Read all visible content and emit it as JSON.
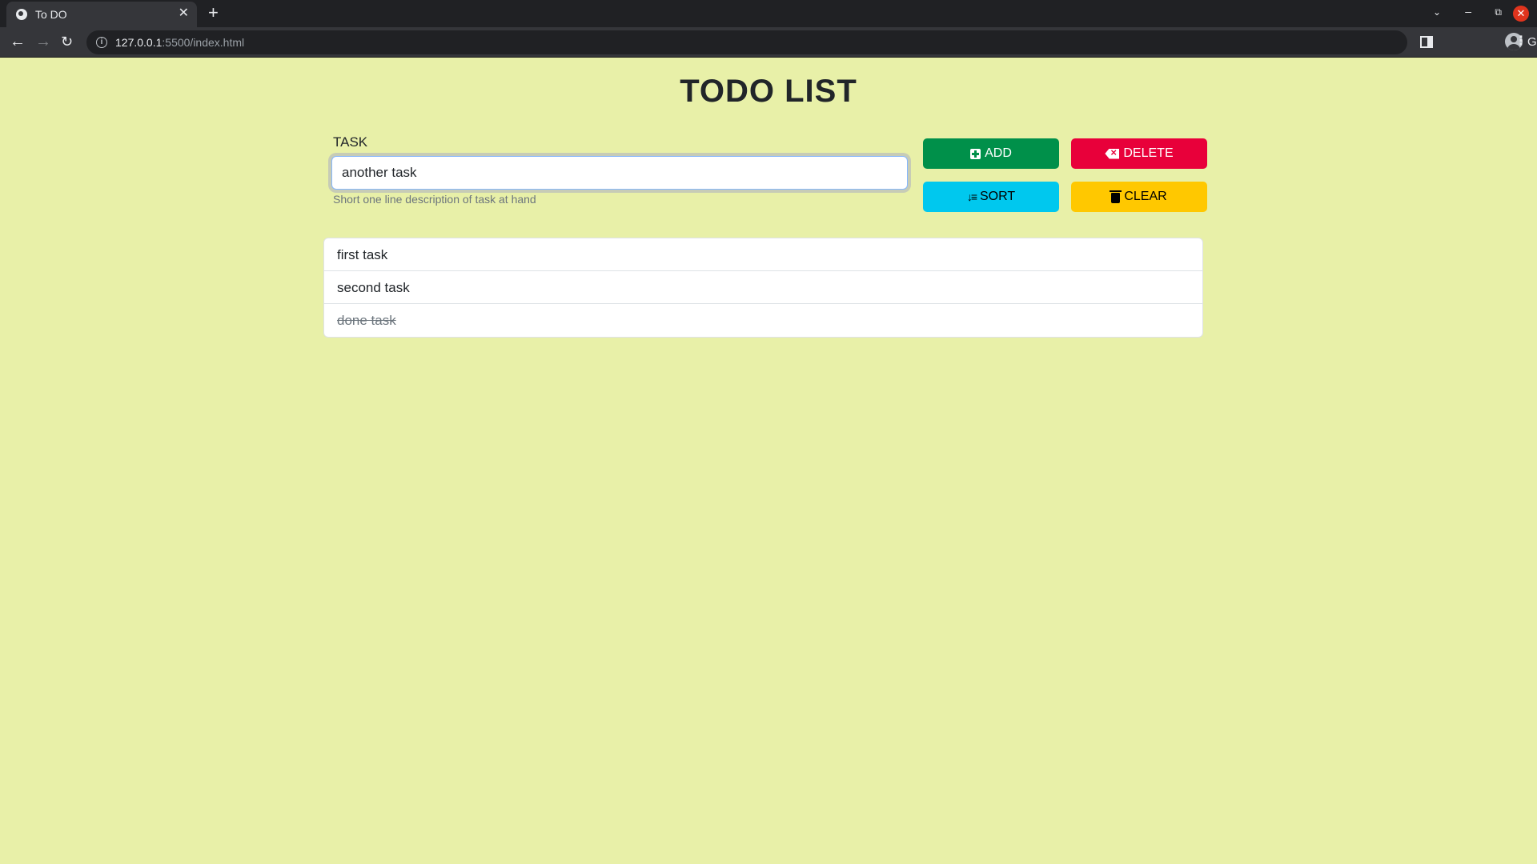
{
  "browser": {
    "tab_title": "To DO",
    "tab_close": "✕",
    "new_tab": "+",
    "url_host": "127.0.0.1",
    "url_path": ":5500/index.html",
    "profile_name": "Guest"
  },
  "page": {
    "title": "TODO LIST",
    "task_label": "TASK",
    "task_value": "another task",
    "task_help": "Short one line description of task at hand",
    "buttons": {
      "add": "ADD",
      "delete": "DELETE",
      "sort": "SORT",
      "clear": "CLEAR"
    },
    "tasks": [
      {
        "text": "first task",
        "done": false
      },
      {
        "text": "second task",
        "done": false
      },
      {
        "text": "done task",
        "done": true
      }
    ]
  },
  "colors": {
    "background": "#e8f0a8",
    "add": "#00904a",
    "delete": "#e8003a",
    "sort": "#00c8ee",
    "clear": "#ffc800"
  },
  "icons": [
    "globe-icon",
    "close-icon",
    "plus-icon",
    "chevron-down-icon",
    "minimize-icon",
    "maximize-icon",
    "back-arrow-icon",
    "forward-arrow-icon",
    "reload-icon",
    "info-icon",
    "side-panel-icon",
    "profile-icon",
    "kebab-menu-icon",
    "plus-square-icon",
    "backspace-icon",
    "sort-icon",
    "trash-icon"
  ]
}
